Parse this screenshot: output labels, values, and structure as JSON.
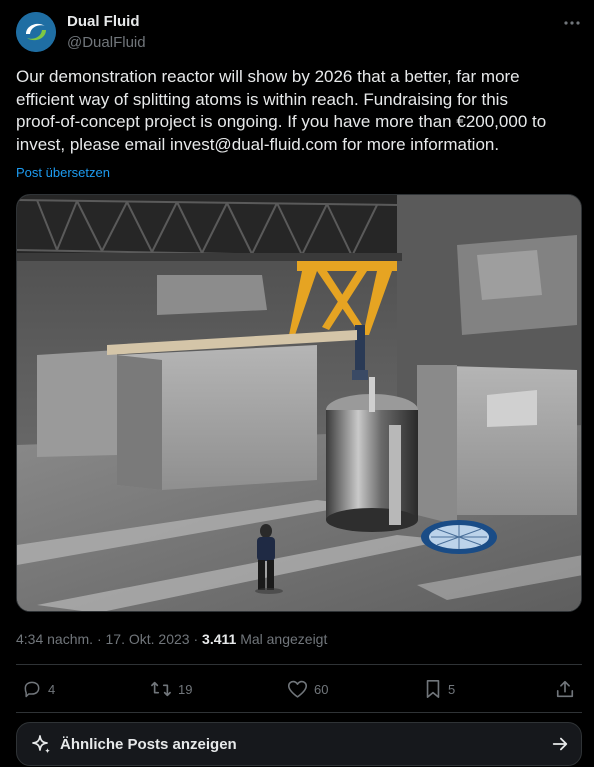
{
  "author": {
    "name": "Dual Fluid",
    "handle": "@DualFluid"
  },
  "post": {
    "text": "Our demonstration reactor will show by 2026 that a better, far more\nefficient way of splitting atoms is within reach. Fundraising for this\nproof-of-concept project is ongoing. If you have more than €200,000 to\ninvest, please email invest@dual-fluid.com for more information.",
    "translate_label": "Post übersetzen"
  },
  "meta": {
    "time": "4:34 nachm.",
    "separator": "·",
    "date": "17. Okt. 2023",
    "views": "3.411",
    "views_label": "Mal angezeigt"
  },
  "actions": {
    "replies": "4",
    "reposts": "19",
    "likes": "60",
    "bookmarks": "5"
  },
  "similar": {
    "label": "Ähnliche Posts anzeigen"
  },
  "icons": {
    "more": "more-icon",
    "reply": "reply-icon",
    "repost": "repost-icon",
    "like": "like-icon",
    "bookmark": "bookmark-icon",
    "share": "share-icon",
    "sparkle": "sparkle-icon",
    "arrow": "arrow-right-icon"
  },
  "colors": {
    "background": "#000000",
    "text": "#e7e9ea",
    "muted": "#71767b",
    "link": "#1d9bf0",
    "border": "#2f3336",
    "crane_yellow": "#e6a422"
  }
}
